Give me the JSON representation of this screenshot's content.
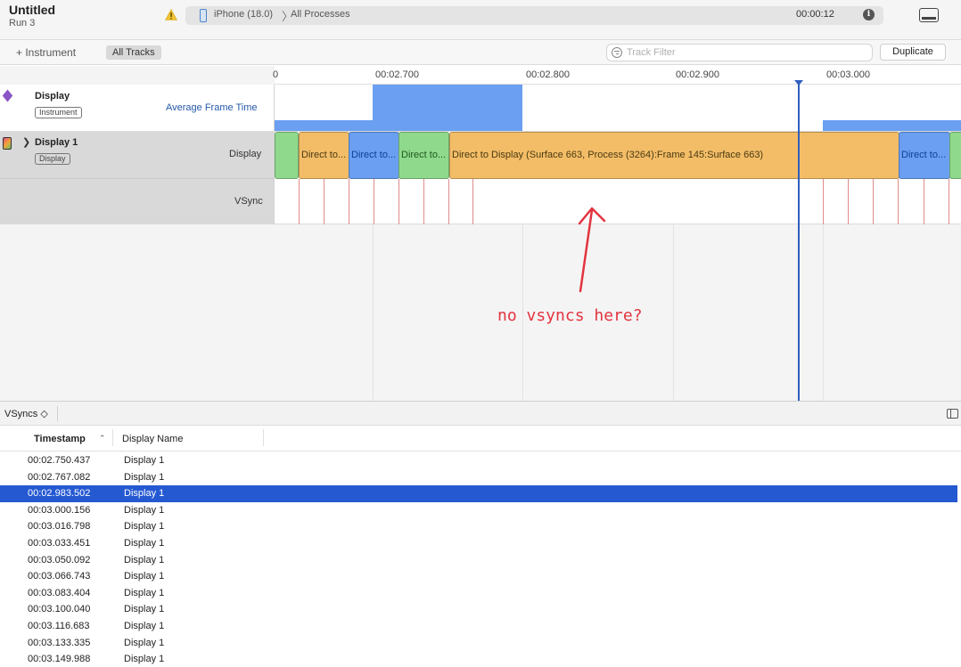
{
  "header": {
    "title": "Untitled",
    "subtitle": "Run 3",
    "device": "iPhone (18.0)",
    "process": "All Processes",
    "timer": "00:00:12",
    "separator": "〉"
  },
  "toolbar": {
    "add_instrument": "+ Instrument",
    "all_tracks": "All Tracks",
    "track_filter_placeholder": "Track Filter",
    "duplicate": "Duplicate"
  },
  "ruler": {
    "labels": [
      "00:02.700",
      "00:02.800",
      "00:02.900",
      "00:03.000"
    ]
  },
  "tracks": {
    "display_instrument": {
      "name": "Display",
      "badge": "Instrument",
      "metric": "Average Frame Time"
    },
    "display1": {
      "name": "Display 1",
      "badge": "Display",
      "lane_display": "Display",
      "lane_vsync": "VSync"
    }
  },
  "intervals": [
    {
      "label": "",
      "color": "green"
    },
    {
      "label": "Direct to...",
      "color": "orange"
    },
    {
      "label": "Direct to...",
      "color": "blue"
    },
    {
      "label": "Direct to...",
      "color": "green"
    },
    {
      "label": "Direct to Display (Surface 663, Process (3264):Frame 145:Surface 663)",
      "color": "orange"
    },
    {
      "label": "Direct to...",
      "color": "blue"
    },
    {
      "label": "",
      "color": "green"
    }
  ],
  "annotation": {
    "text": "no vsyncs here?",
    "color": "#e3343f"
  },
  "detail": {
    "selector": "VSyncs ◇",
    "columns": {
      "timestamp": "Timestamp",
      "display_name": "Display Name",
      "sort": "⌃"
    },
    "rows": [
      {
        "timestamp": "00:02.750.437",
        "display": "Display 1",
        "selected": false
      },
      {
        "timestamp": "00:02.767.082",
        "display": "Display 1",
        "selected": false
      },
      {
        "timestamp": "00:02.983.502",
        "display": "Display 1",
        "selected": true
      },
      {
        "timestamp": "00:03.000.156",
        "display": "Display 1",
        "selected": false
      },
      {
        "timestamp": "00:03.016.798",
        "display": "Display 1",
        "selected": false
      },
      {
        "timestamp": "00:03.033.451",
        "display": "Display 1",
        "selected": false
      },
      {
        "timestamp": "00:03.050.092",
        "display": "Display 1",
        "selected": false
      },
      {
        "timestamp": "00:03.066.743",
        "display": "Display 1",
        "selected": false
      },
      {
        "timestamp": "00:03.083.404",
        "display": "Display 1",
        "selected": false
      },
      {
        "timestamp": "00:03.100.040",
        "display": "Display 1",
        "selected": false
      },
      {
        "timestamp": "00:03.116.683",
        "display": "Display 1",
        "selected": false
      },
      {
        "timestamp": "00:03.133.335",
        "display": "Display 1",
        "selected": false
      },
      {
        "timestamp": "00:03.149.988",
        "display": "Display 1",
        "selected": false
      }
    ]
  },
  "colors": {
    "accent": "#2559d2",
    "playhead": "#2f5fbf",
    "vsync_tick": "#e08b8b",
    "bar_orange": "#f3bd68",
    "bar_blue": "#6a9ff1",
    "bar_green": "#8fd98c"
  }
}
